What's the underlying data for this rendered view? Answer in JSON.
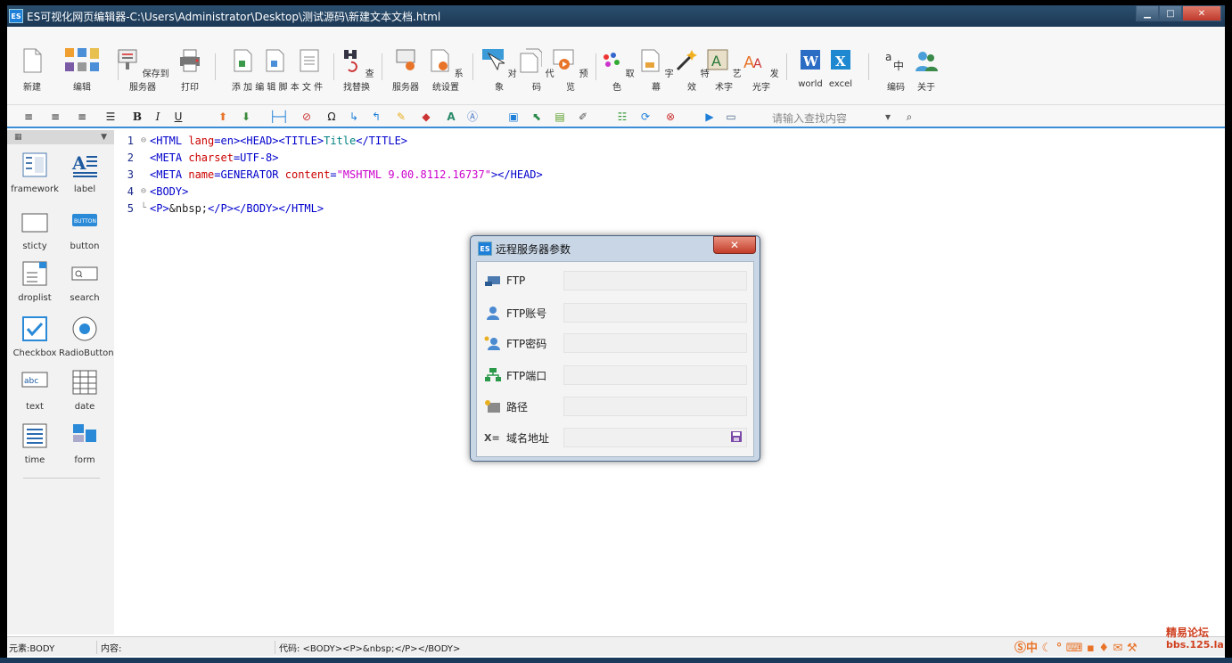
{
  "window": {
    "title": "ES可视化网页编辑器-C:\\Users\\Administrator\\Desktop\\测试源码\\新建文本文档.html",
    "badge": "ES",
    "min": "▁",
    "max": "□",
    "close": "✕"
  },
  "ribbon": {
    "items": [
      {
        "label": "新建",
        "icon": "new-file-icon"
      },
      {
        "label": "编辑",
        "icon": "edit-group-icon"
      },
      {
        "label": "保存到服务器",
        "icon": "save-server-icon"
      },
      {
        "label": "打印",
        "icon": "printer-icon"
      },
      {
        "label": "添 加 编 辑 脚 本 文 件",
        "icon": "script-icon"
      },
      {
        "label": "查找替换",
        "icon": "find-replace-icon"
      },
      {
        "label": "服务器",
        "icon": "server-icon"
      },
      {
        "label": "系统设置",
        "icon": "settings-icon"
      },
      {
        "label": "对象",
        "icon": "object-icon"
      },
      {
        "label": "代码",
        "icon": "code-icon"
      },
      {
        "label": "预览",
        "icon": "preview-icon"
      },
      {
        "label": "取色",
        "icon": "color-picker-icon"
      },
      {
        "label": "字幕",
        "icon": "subtitle-icon"
      },
      {
        "label": "特效",
        "icon": "effects-icon"
      },
      {
        "label": "艺术字",
        "icon": "art-text-icon"
      },
      {
        "label": "发光字",
        "icon": "glow-text-icon"
      },
      {
        "label": "world",
        "icon": "word-icon"
      },
      {
        "label": "excel",
        "icon": "excel-icon"
      },
      {
        "label": "编码",
        "icon": "encoding-icon"
      },
      {
        "label": "关于",
        "icon": "about-icon"
      }
    ]
  },
  "format": {
    "bold": "B",
    "italic": "I",
    "underline": "U",
    "omega": "Ω",
    "text_a": "A",
    "search_placeholder": "请输入查找内容"
  },
  "components": [
    {
      "label": "framework",
      "icon": "framework-icon"
    },
    {
      "label": "label",
      "icon": "label-icon"
    },
    {
      "label": "sticty",
      "icon": "sticky-icon"
    },
    {
      "label": "button",
      "icon": "button-icon"
    },
    {
      "label": "droplist",
      "icon": "droplist-icon"
    },
    {
      "label": "search",
      "icon": "search-icon"
    },
    {
      "label": "Checkbox",
      "icon": "checkbox-icon"
    },
    {
      "label": "RadioButton",
      "icon": "radio-icon"
    },
    {
      "label": "text",
      "icon": "text-icon"
    },
    {
      "label": "date",
      "icon": "date-icon"
    },
    {
      "label": "time",
      "icon": "time-icon"
    },
    {
      "label": "form",
      "icon": "form-icon"
    }
  ],
  "button_caption": "BUTTON",
  "textbox_caption": "abc",
  "code": {
    "l1": {
      "n": "1",
      "a": "<HTML ",
      "b": "lang",
      "c": "=en>",
      "d": "<HEAD>",
      "e": "<TITLE>",
      "f": "Title",
      "g": "</TITLE>"
    },
    "l2": {
      "n": "2",
      "a": "<META ",
      "b": "charset",
      "c": "=UTF-8>"
    },
    "l3": {
      "n": "3",
      "a": "<META ",
      "b": "name",
      "c": "=GENERATOR ",
      "d": "content",
      "e": "=",
      "f": "\"MSHTML 9.00.8112.16737\"",
      "g": "></HEAD>"
    },
    "l4": {
      "n": "4",
      "a": "<BODY>"
    },
    "l5": {
      "n": "5",
      "a": "<P>",
      "b": "&nbsp;",
      "c": "</P></BODY></HTML>"
    }
  },
  "dialog": {
    "badge": "ES",
    "title": "远程服务器参数",
    "close": "✕",
    "fields": [
      {
        "label": "FTP",
        "icon": "ftp-server-icon",
        "value": ""
      },
      {
        "label": "FTP账号",
        "icon": "user-icon",
        "value": ""
      },
      {
        "label": "FTP密码",
        "icon": "password-icon",
        "value": ""
      },
      {
        "label": "FTP端口",
        "icon": "port-icon",
        "value": ""
      },
      {
        "label": "路径",
        "icon": "path-icon",
        "value": ""
      },
      {
        "label": "域名地址",
        "icon": "domain-icon",
        "value": ""
      }
    ]
  },
  "status": {
    "element": "元素:BODY",
    "content": "内容:",
    "code": "代码:  <BODY><P>&nbsp;</P></BODY>"
  },
  "watermark": {
    "line1": "精易论坛",
    "line2": "bbs.125.la"
  }
}
